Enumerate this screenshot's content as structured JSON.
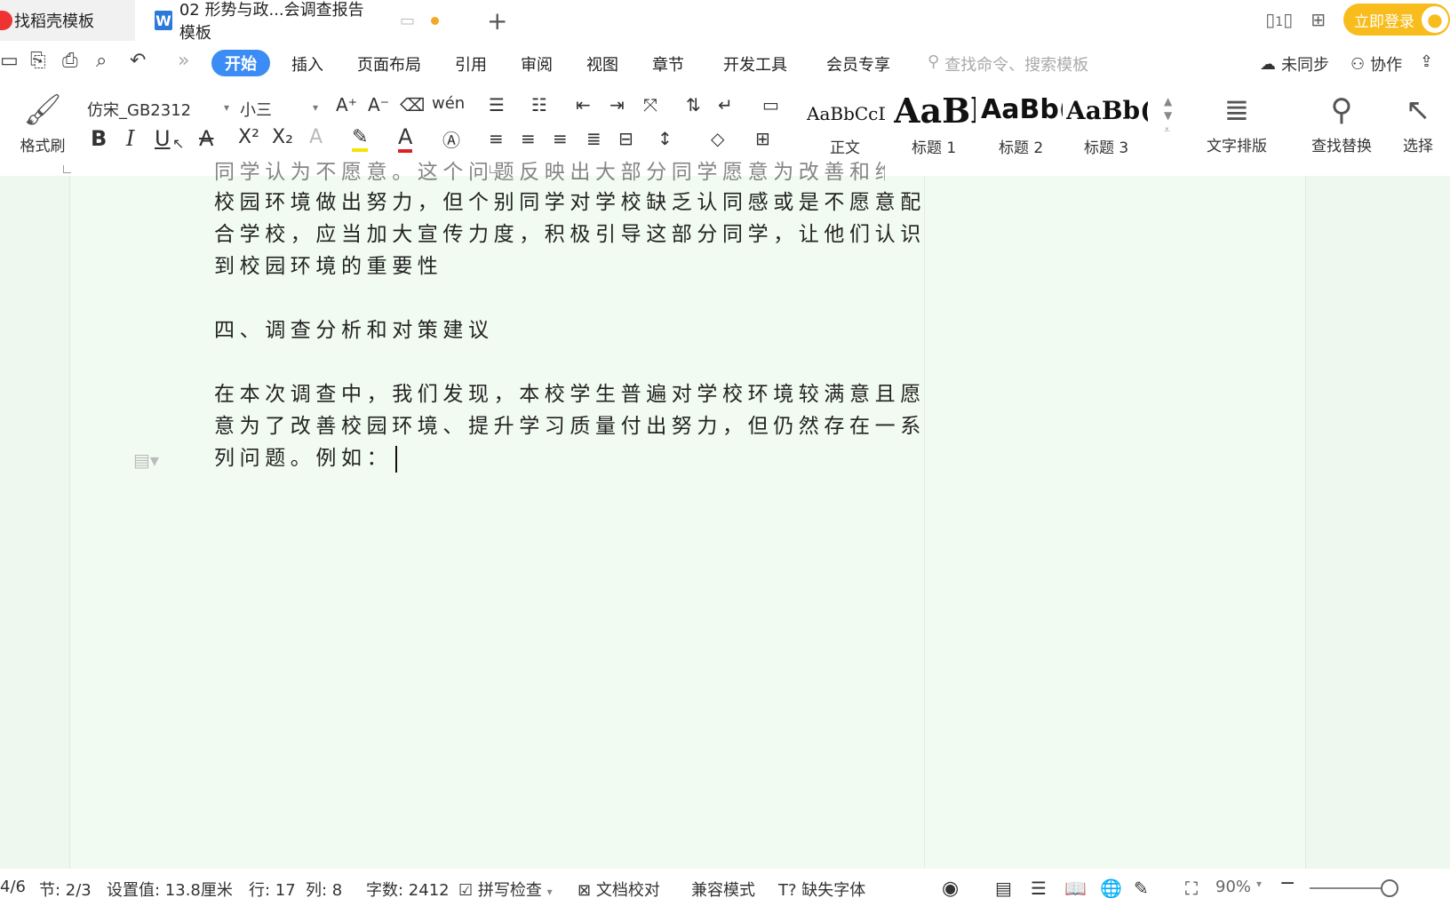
{
  "titlebar": {
    "home_tab": "找稻壳模板",
    "doc_tab": "02 形势与政...会调查报告模板",
    "doc_icon": "W",
    "login_label": "立即登录",
    "page_indicator": "1"
  },
  "menu": {
    "active": "开始",
    "items": [
      "插入",
      "页面布局",
      "引用",
      "审阅",
      "视图",
      "章节",
      "开发工具",
      "会员专享"
    ],
    "search_placeholder": "查找命令、搜索模板",
    "sync": "未同步",
    "collab": "协作",
    "share": "分"
  },
  "toolbar": {
    "format_painter": "格式刷",
    "font_name": "仿宋_GB2312",
    "font_size": "小三",
    "phonetic": "wén",
    "styles": [
      {
        "sample": "AaBbCcDd",
        "label": "正文"
      },
      {
        "sample": "AaBl",
        "label": "标题 1"
      },
      {
        "sample": "AaBb(",
        "label": "标题 2"
      },
      {
        "sample": "AaBb(",
        "label": "标题 3"
      }
    ],
    "text_layout": "文字排版",
    "find_replace": "查找替换",
    "select": "选择"
  },
  "document": {
    "lines": [
      "同学认为不愿意。这个问题反映出大部分同学愿意为改善和维护",
      "校园环境做出努力，但个别同学对学校缺乏认同感或是不愿意配",
      "合学校，应当加大宣传力度，积极引导这部分同学，让他们认识",
      "到校园环境的重要性",
      "",
      "四、调查分析和对策建议",
      "",
      "在本次调查中，我们发现，本校学生普遍对学校环境较满意且愿",
      "意为了改善校园环境、提升学习质量付出努力，但仍然存在一系",
      "列问题。例如："
    ]
  },
  "status": {
    "page": "4/6",
    "section": "节: 2/3",
    "setting": "设置值: 13.8厘米",
    "row": "行: 17",
    "col": "列: 8",
    "words": "字数: 2412",
    "spell": "拼写检查",
    "proof": "文档校对",
    "compat": "兼容模式",
    "missing_font": "缺失字体",
    "zoom": "90%"
  }
}
